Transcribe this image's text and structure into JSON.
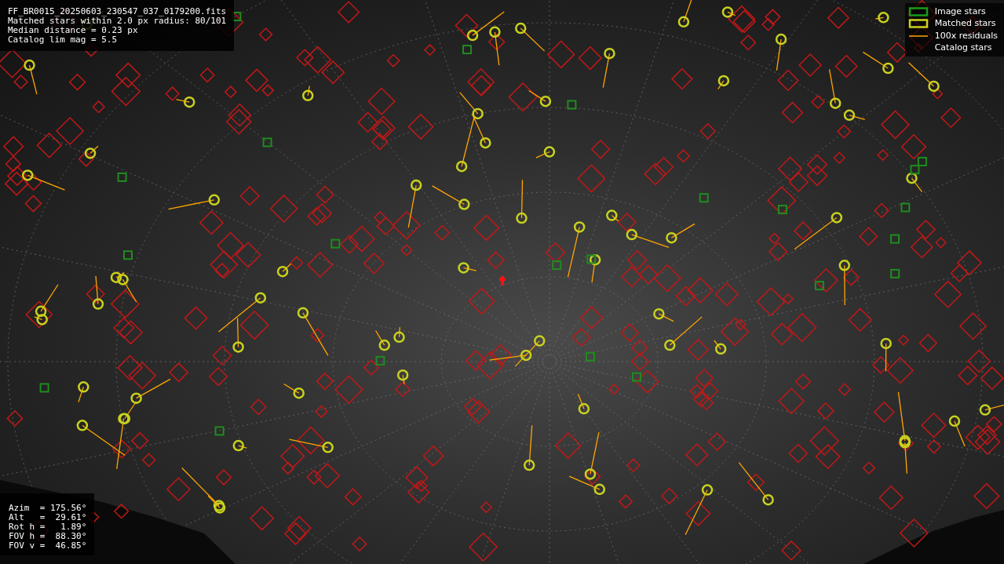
{
  "file_info": {
    "lines": [
      "FF_BR0015_20250603_230547_037_0179200.fits",
      "Matched stars within 2.0 px radius: 80/101",
      "Median distance = 0.23 px",
      "Catalog lim mag = 5.5"
    ]
  },
  "legend": [
    {
      "label": "Image stars",
      "kind": "image"
    },
    {
      "label": "Matched stars",
      "kind": "matched"
    },
    {
      "label": "100x residuals",
      "kind": "residual"
    },
    {
      "label": "Catalog stars",
      "kind": "catalog"
    }
  ],
  "pointing": {
    "lines": [
      "Azim  = 175.56°",
      "Alt   =  29.61°",
      "Rot h =   1.89°",
      "FOV h =  88.30°",
      "FOV v =  46.85°"
    ]
  }
}
